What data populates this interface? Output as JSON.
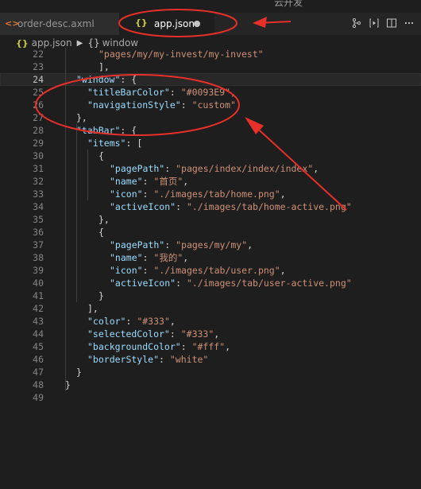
{
  "window": {
    "title": "云开发"
  },
  "tabs": [
    {
      "label": "order-desc.axml",
      "icon": "xml-icon"
    },
    {
      "label": "app.json",
      "icon": "json-icon"
    }
  ],
  "actions": [
    "source-control-icon",
    "preview-icon",
    "split-editor-icon",
    "more-icon"
  ],
  "breadcrumb": {
    "file": "app.json",
    "item": "window"
  },
  "lines": [
    {
      "n": "22",
      "indent": 6,
      "tokens": [
        {
          "t": "\"pages/my/my-invest/my-invest\"",
          "c": "s"
        }
      ]
    },
    {
      "n": "23",
      "indent": 6,
      "tokens": [
        {
          "t": "],",
          "c": "p"
        }
      ]
    },
    {
      "n": "24",
      "indent": 2,
      "tokens": [
        {
          "t": "\"window\"",
          "c": "k"
        },
        {
          "t": ": {",
          "c": "p"
        }
      ]
    },
    {
      "n": "25",
      "indent": 4,
      "tokens": [
        {
          "t": "\"titleBarColor\"",
          "c": "k"
        },
        {
          "t": ": ",
          "c": "p"
        },
        {
          "t": "\"#0093E9\"",
          "c": "s"
        },
        {
          "t": ",",
          "c": "p"
        }
      ]
    },
    {
      "n": "26",
      "indent": 4,
      "tokens": [
        {
          "t": "\"navigationStyle\"",
          "c": "k"
        },
        {
          "t": ": ",
          "c": "p"
        },
        {
          "t": "\"custom\"",
          "c": "s"
        }
      ]
    },
    {
      "n": "27",
      "indent": 2,
      "tokens": [
        {
          "t": "},",
          "c": "p"
        }
      ]
    },
    {
      "n": "28",
      "indent": 2,
      "tokens": [
        {
          "t": "\"tabBar\"",
          "c": "k"
        },
        {
          "t": ": {",
          "c": "p"
        }
      ]
    },
    {
      "n": "29",
      "indent": 4,
      "tokens": [
        {
          "t": "\"items\"",
          "c": "k"
        },
        {
          "t": ": [",
          "c": "p"
        }
      ]
    },
    {
      "n": "30",
      "indent": 6,
      "tokens": [
        {
          "t": "{",
          "c": "p"
        }
      ]
    },
    {
      "n": "31",
      "indent": 8,
      "tokens": [
        {
          "t": "\"pagePath\"",
          "c": "k"
        },
        {
          "t": ": ",
          "c": "p"
        },
        {
          "t": "\"pages/index/index/index\"",
          "c": "s"
        },
        {
          "t": ",",
          "c": "p"
        }
      ]
    },
    {
      "n": "32",
      "indent": 8,
      "tokens": [
        {
          "t": "\"name\"",
          "c": "k"
        },
        {
          "t": ": ",
          "c": "p"
        },
        {
          "t": "\"首页\"",
          "c": "s"
        },
        {
          "t": ",",
          "c": "p"
        }
      ]
    },
    {
      "n": "33",
      "indent": 8,
      "tokens": [
        {
          "t": "\"icon\"",
          "c": "k"
        },
        {
          "t": ": ",
          "c": "p"
        },
        {
          "t": "\"./images/tab/home.png\"",
          "c": "s"
        },
        {
          "t": ",",
          "c": "p"
        }
      ]
    },
    {
      "n": "34",
      "indent": 8,
      "tokens": [
        {
          "t": "\"activeIcon\"",
          "c": "k"
        },
        {
          "t": ": ",
          "c": "p"
        },
        {
          "t": "\"./images/tab/home-active.png\"",
          "c": "s"
        }
      ]
    },
    {
      "n": "35",
      "indent": 6,
      "tokens": [
        {
          "t": "},",
          "c": "p"
        }
      ]
    },
    {
      "n": "36",
      "indent": 6,
      "tokens": [
        {
          "t": "{",
          "c": "p"
        }
      ]
    },
    {
      "n": "37",
      "indent": 8,
      "tokens": [
        {
          "t": "\"pagePath\"",
          "c": "k"
        },
        {
          "t": ": ",
          "c": "p"
        },
        {
          "t": "\"pages/my/my\"",
          "c": "s"
        },
        {
          "t": ",",
          "c": "p"
        }
      ]
    },
    {
      "n": "38",
      "indent": 8,
      "tokens": [
        {
          "t": "\"name\"",
          "c": "k"
        },
        {
          "t": ": ",
          "c": "p"
        },
        {
          "t": "\"我的\"",
          "c": "s"
        },
        {
          "t": ",",
          "c": "p"
        }
      ]
    },
    {
      "n": "39",
      "indent": 8,
      "tokens": [
        {
          "t": "\"icon\"",
          "c": "k"
        },
        {
          "t": ": ",
          "c": "p"
        },
        {
          "t": "\"./images/tab/user.png\"",
          "c": "s"
        },
        {
          "t": ",",
          "c": "p"
        }
      ]
    },
    {
      "n": "40",
      "indent": 8,
      "tokens": [
        {
          "t": "\"activeIcon\"",
          "c": "k"
        },
        {
          "t": ": ",
          "c": "p"
        },
        {
          "t": "\"./images/tab/user-active.png\"",
          "c": "s"
        }
      ]
    },
    {
      "n": "41",
      "indent": 6,
      "tokens": [
        {
          "t": "}",
          "c": "p"
        }
      ]
    },
    {
      "n": "42",
      "indent": 4,
      "tokens": [
        {
          "t": "],",
          "c": "p"
        }
      ]
    },
    {
      "n": "43",
      "indent": 4,
      "tokens": [
        {
          "t": "\"color\"",
          "c": "k"
        },
        {
          "t": ": ",
          "c": "p"
        },
        {
          "t": "\"#333\"",
          "c": "s"
        },
        {
          "t": ",",
          "c": "p"
        }
      ]
    },
    {
      "n": "44",
      "indent": 4,
      "tokens": [
        {
          "t": "\"selectedColor\"",
          "c": "k"
        },
        {
          "t": ": ",
          "c": "p"
        },
        {
          "t": "\"#333\"",
          "c": "s"
        },
        {
          "t": ",",
          "c": "p"
        }
      ]
    },
    {
      "n": "45",
      "indent": 4,
      "tokens": [
        {
          "t": "\"backgroundColor\"",
          "c": "k"
        },
        {
          "t": ": ",
          "c": "p"
        },
        {
          "t": "\"#fff\"",
          "c": "s"
        },
        {
          "t": ",",
          "c": "p"
        }
      ]
    },
    {
      "n": "46",
      "indent": 4,
      "tokens": [
        {
          "t": "\"borderStyle\"",
          "c": "k"
        },
        {
          "t": ": ",
          "c": "p"
        },
        {
          "t": "\"white\"",
          "c": "s"
        }
      ]
    },
    {
      "n": "47",
      "indent": 2,
      "tokens": [
        {
          "t": "}",
          "c": "p"
        }
      ]
    },
    {
      "n": "48",
      "indent": 0,
      "tokens": [
        {
          "t": "}",
          "c": "p"
        }
      ]
    },
    {
      "n": "49",
      "indent": 0,
      "tokens": []
    }
  ],
  "current_line": "24",
  "annotation_color": "#e8302a",
  "colors": {
    "key": "#9cdcfe",
    "string": "#ce9178",
    "punct": "#d4d4d4",
    "bg": "#1e1e1e"
  }
}
